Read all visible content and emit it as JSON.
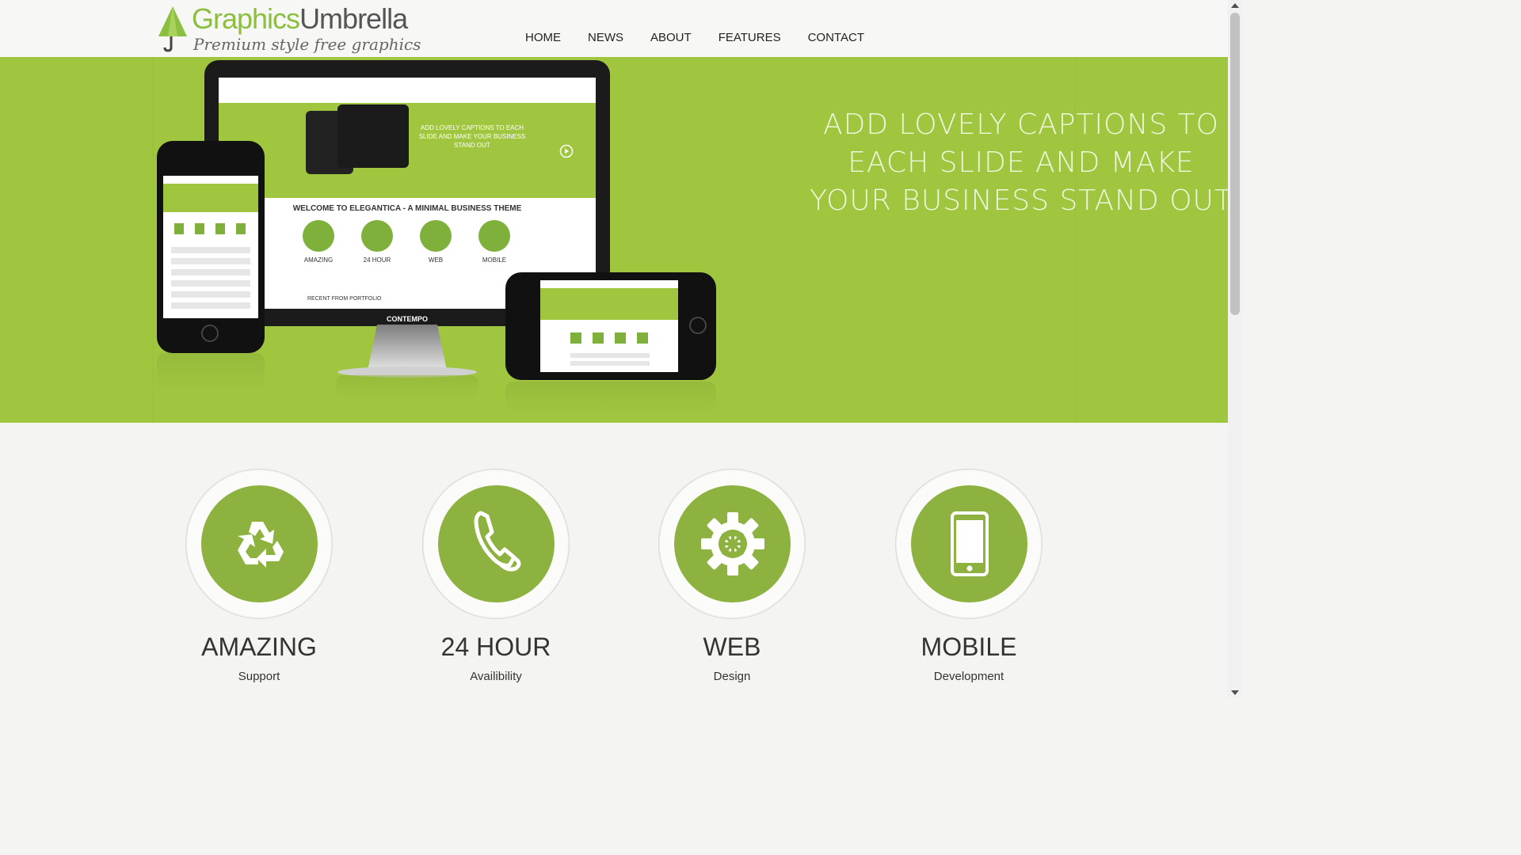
{
  "header": {
    "logo": {
      "brand_part1": "Graphics",
      "brand_part2": "Umbrella",
      "tagline": "Premium style free graphics"
    },
    "nav": [
      "HOME",
      "NEWS",
      "ABOUT",
      "FEATURES",
      "CONTACT"
    ]
  },
  "hero": {
    "caption": "ADD LOVELY CAPTIONS TO EACH SLIDE AND MAKE YOUR BUSINESS STAND OUT",
    "mockup": {
      "caption": "ADD LOVELY CAPTIONS TO EACH SLIDE AND MAKE YOUR BUSINESS STAND OUT",
      "welcome": "WELCOME TO ELEGANTICA - A MINIMAL BUSINESS THEME",
      "icons": [
        "AMAZING",
        "24 HOUR",
        "WEB",
        "MOBILE"
      ],
      "recent": "RECENT FROM PORTFOLIO",
      "monitor_label": "CONTEMPO"
    },
    "background_color": "#a0c63f"
  },
  "features": [
    {
      "icon": "recycle-icon",
      "title": "AMAZING",
      "subtitle": "Support"
    },
    {
      "icon": "phone-icon",
      "title": "24 HOUR",
      "subtitle": "Availibility"
    },
    {
      "icon": "gear-icon",
      "title": "WEB",
      "subtitle": "Design"
    },
    {
      "icon": "mobile-icon",
      "title": "MOBILE",
      "subtitle": "Development"
    }
  ],
  "colors": {
    "accent": "#8db23f",
    "text": "#333333"
  }
}
